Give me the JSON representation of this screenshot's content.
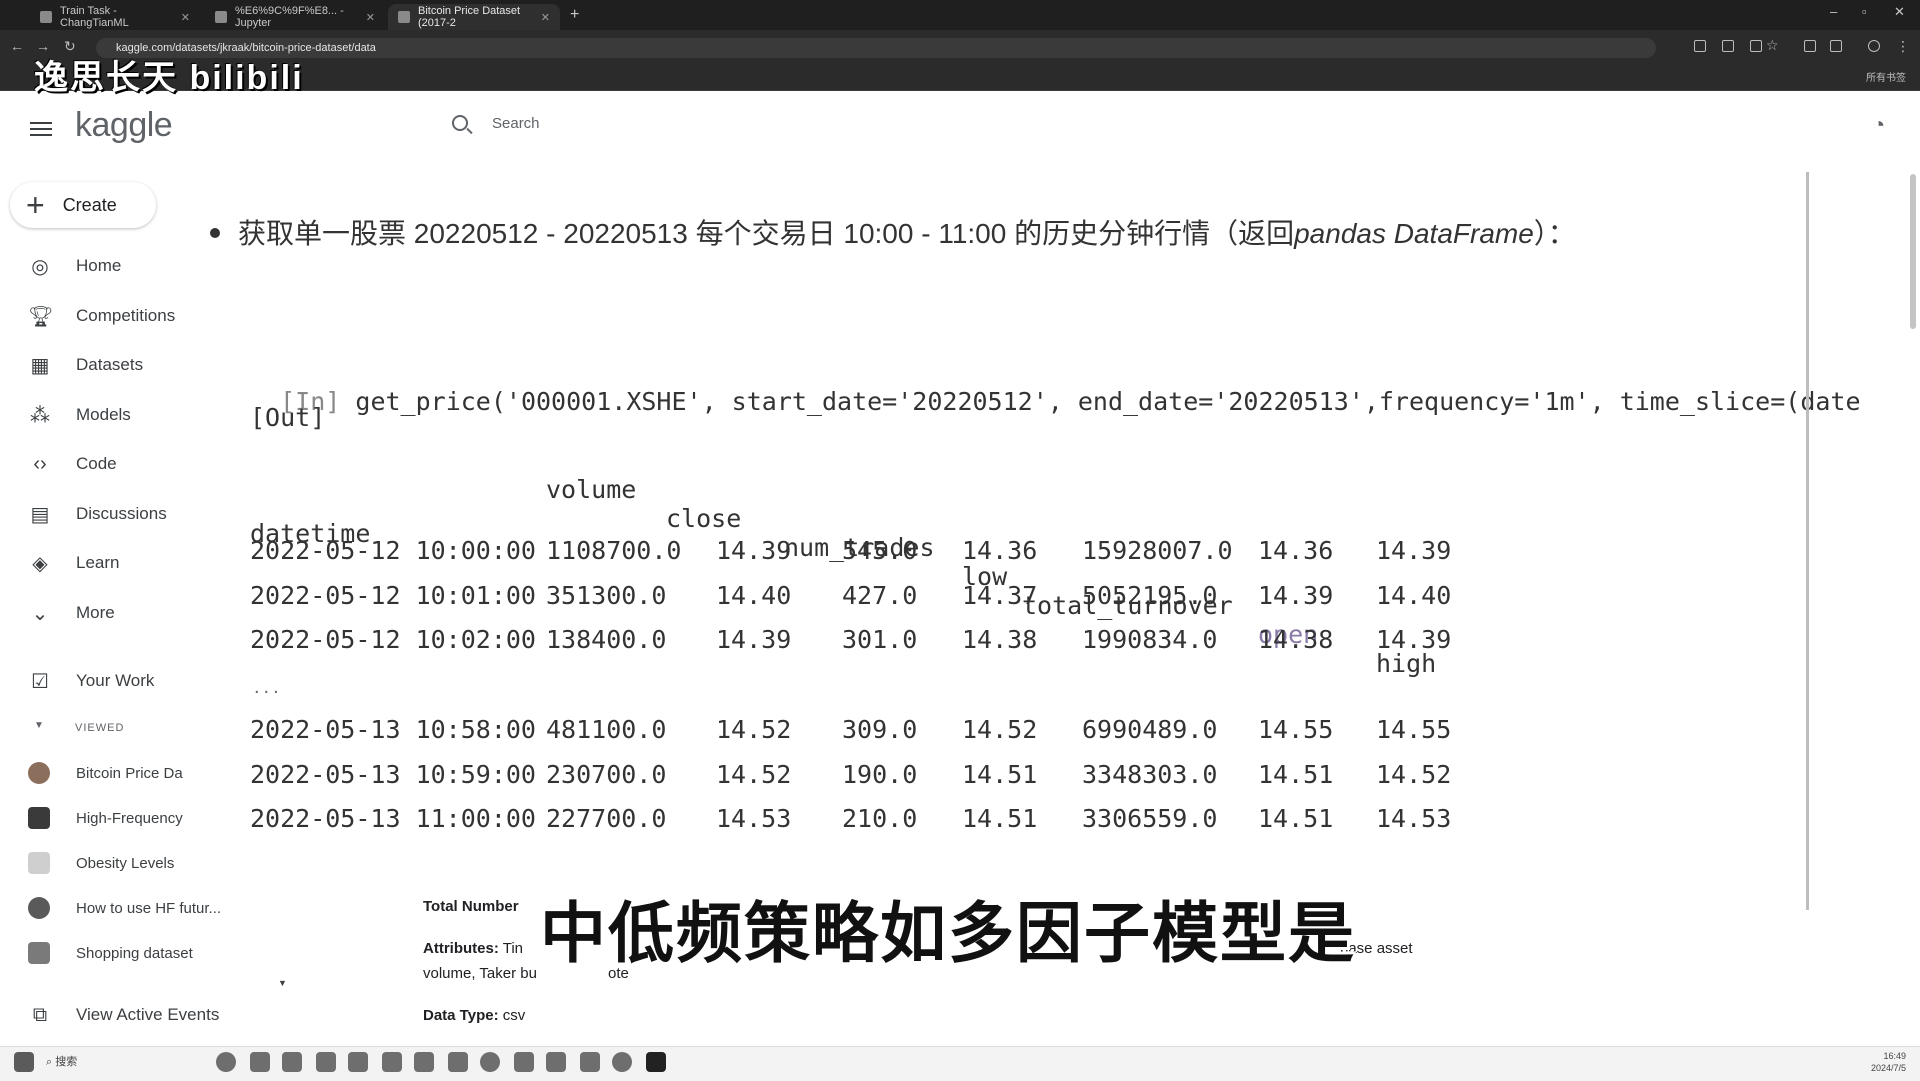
{
  "browser": {
    "tabs": [
      {
        "label": "Train Task - ChangTianML",
        "active": false
      },
      {
        "label": "%E6%9C%9F%E8... - Jupyter",
        "active": false
      },
      {
        "label": "Bitcoin Price Dataset (2017-2",
        "active": true
      }
    ],
    "url": "kaggle.com/datasets/jkraak/bitcoin-price-dataset/data",
    "bookmarks_folder": "所有书签"
  },
  "watermark": "逸思长天 bilibili",
  "header": {
    "logo": "kaggle",
    "search_placeholder": "Search"
  },
  "sidebar": {
    "create_label": "Create",
    "nav": [
      {
        "label": "Home",
        "icon": "compass-icon"
      },
      {
        "label": "Competitions",
        "icon": "trophy-icon"
      },
      {
        "label": "Datasets",
        "icon": "table-icon"
      },
      {
        "label": "Models",
        "icon": "models-icon"
      },
      {
        "label": "Code",
        "icon": "code-icon"
      },
      {
        "label": "Discussions",
        "icon": "discussion-icon"
      },
      {
        "label": "Learn",
        "icon": "graduation-cap-icon"
      },
      {
        "label": "More",
        "icon": "chevron-down-icon"
      }
    ],
    "your_work": "Your Work",
    "viewed_label": "VIEWED",
    "viewed": [
      {
        "label": "Bitcoin Price Da"
      },
      {
        "label": "High-Frequency"
      },
      {
        "label": "Obesity Levels"
      },
      {
        "label": "How to use HF futur..."
      },
      {
        "label": "Shopping dataset"
      }
    ],
    "view_events": "View Active Events"
  },
  "slide": {
    "bullet_text": "获取单一股票 20220512 - 20220513 每个交易日 10:00 - 11:00 的历史分钟行情（返回",
    "bullet_em": "pandas DataFrame",
    "bullet_tail": "）：",
    "code_in_label": "[In]",
    "code_in": "get_price('000001.XSHE', start_date='20220512', end_date='20220513',frequency='1m', time_slice=(date",
    "code_out_label": "[Out]",
    "columns": [
      "volume",
      "close",
      "num_trades",
      "low",
      "total_turnover",
      "open",
      "high"
    ],
    "index_name": "datetime",
    "rows_top": [
      [
        "2022-05-12 10:00:00",
        "1108700.0",
        "14.39",
        "545.0",
        "14.36",
        "15928007.0",
        "14.36",
        "14.39"
      ],
      [
        "2022-05-12 10:01:00",
        "351300.0",
        "14.40",
        "427.0",
        "14.37",
        "5052195.0",
        "14.39",
        "14.40"
      ],
      [
        "2022-05-12 10:02:00",
        "138400.0",
        "14.39",
        "301.0",
        "14.38",
        "1990834.0",
        "14.38",
        "14.39"
      ]
    ],
    "ellipsis": "...",
    "rows_bottom": [
      [
        "2022-05-13 10:58:00",
        "481100.0",
        "14.52",
        "309.0",
        "14.52",
        "6990489.0",
        "14.55",
        "14.55"
      ],
      [
        "2022-05-13 10:59:00",
        "230700.0",
        "14.52",
        "190.0",
        "14.51",
        "3348303.0",
        "14.51",
        "14.52"
      ],
      [
        "2022-05-13 11:00:00",
        "227700.0",
        "14.53",
        "210.0",
        "14.51",
        "3306559.0",
        "14.51",
        "14.53"
      ]
    ]
  },
  "underlying": {
    "total_number": "Total Number",
    "attributes_label": "Attributes:",
    "attributes_start": "Tin",
    "attributes_end": "base asset",
    "attributes_line2": "volume, Taker bu",
    "attributes_line2_end": "ote",
    "data_type_label": "Data Type:",
    "data_type_value": "csv"
  },
  "subtitle": "中低频策略如多因子模型是",
  "taskbar": {
    "search_label": "搜索",
    "time": "16:49",
    "date": "2024/7/5"
  }
}
